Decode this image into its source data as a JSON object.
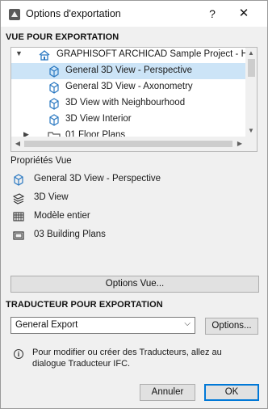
{
  "window": {
    "title": "Options d'exportation",
    "help_label": "?",
    "close_label": "✕"
  },
  "view_section": {
    "heading": "VUE POUR EXPORTATION",
    "tree": [
      {
        "label": "GRAPHISOFT ARCHICAD Sample Project - Hillside House",
        "icon": "project-icon",
        "expanded": true
      },
      {
        "label": "General 3D View - Perspective",
        "icon": "3d-view-icon",
        "selected": true
      },
      {
        "label": "General 3D View - Axonometry",
        "icon": "3d-view-icon"
      },
      {
        "label": "3D View with Neighbourhood",
        "icon": "3d-view-icon"
      },
      {
        "label": "3D View Interior",
        "icon": "3d-view-icon"
      },
      {
        "label": "01 Floor Plans",
        "icon": "folder-icon",
        "expanded": false
      }
    ]
  },
  "properties": {
    "heading": "Propriétés Vue",
    "items": [
      {
        "label": "General 3D View - Perspective",
        "icon": "3d-view-icon"
      },
      {
        "label": "3D View",
        "icon": "layers-icon"
      },
      {
        "label": "Modèle entier",
        "icon": "model-icon"
      },
      {
        "label": "03 Building Plans",
        "icon": "layout-icon"
      }
    ]
  },
  "view_options_button": "Options Vue...",
  "translator_section": {
    "heading": "TRADUCTEUR POUR EXPORTATION",
    "selected": "General Export",
    "options_button": "Options...",
    "info_text": "Pour modifier ou créer des Traducteurs, allez au dialogue Traducteur IFC."
  },
  "footer": {
    "cancel": "Annuler",
    "ok": "OK"
  },
  "colors": {
    "selection": "#cce4f7",
    "primary_border": "#0078d7",
    "icon_blue": "#2b79c2"
  }
}
